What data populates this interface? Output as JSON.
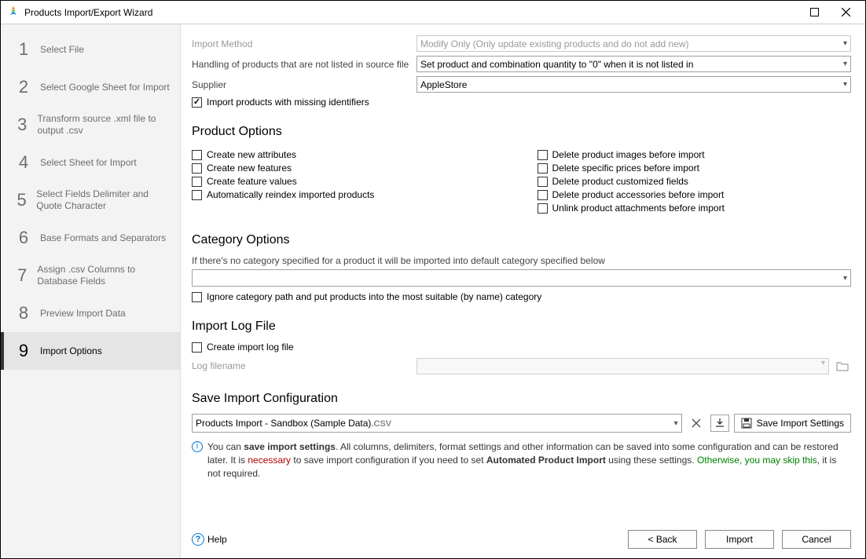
{
  "window": {
    "title": "Products Import/Export Wizard",
    "maximize_tooltip": "Maximize",
    "close_tooltip": "Close"
  },
  "sidebar": {
    "steps": [
      {
        "num": "1",
        "label": "Select File"
      },
      {
        "num": "2",
        "label": "Select Google Sheet for Import"
      },
      {
        "num": "3",
        "label": "Transform source .xml file to output .csv"
      },
      {
        "num": "4",
        "label": "Select Sheet for Import"
      },
      {
        "num": "5",
        "label": "Select Fields Delimiter and Quote Character"
      },
      {
        "num": "6",
        "label": "Base Formats and Separators"
      },
      {
        "num": "7",
        "label": "Assign .csv Columns to Database Fields"
      },
      {
        "num": "8",
        "label": "Preview Import Data"
      },
      {
        "num": "9",
        "label": "Import Options"
      }
    ],
    "active_index": 8
  },
  "header": {
    "import_method_label": "Import Method",
    "import_method_value": "Modify Only (Only update existing products and do not add new)",
    "handling_label": "Handling of products that are not listed in source file",
    "handling_value": "Set product and combination quantity to \"0\" when it is not listed in",
    "supplier_label": "Supplier",
    "supplier_value": "AppleStore",
    "missing_identifiers_label": "Import products with missing identifiers",
    "missing_identifiers_checked": true
  },
  "product_options": {
    "title": "Product Options",
    "left": [
      "Create new attributes",
      "Create new features",
      "Create feature values",
      "Automatically reindex imported products"
    ],
    "right": [
      "Delete product images before import",
      "Delete specific prices before import",
      "Delete product customized fields",
      "Delete product accessories before import",
      "Unlink product attachments before import"
    ]
  },
  "category_options": {
    "title": "Category Options",
    "hint": "If there's no category specified for a product it will be imported into default category specified below",
    "default_value": "",
    "ignore_label": "Ignore category path and put products into the most suitable (by name) category"
  },
  "import_log": {
    "title": "Import Log File",
    "create_label": "Create import log file",
    "filename_label": "Log filename"
  },
  "save_config": {
    "title": "Save Import Configuration",
    "value": "Products Import - Sandbox (Sample Data)",
    "ext": ".CSV",
    "save_btn": "Save Import Settings"
  },
  "info": {
    "t1": "You can ",
    "t2": "save import settings",
    "t3": ". All columns, delimiters, format settings and other information can be saved into some configuration and can be restored later. It is ",
    "t4": "necessary",
    "t5": " to save import configuration if you need to set ",
    "t6": "Automated Product Import",
    "t7": " using these settings. ",
    "t8": "Otherwise, you may skip this",
    "t9": ", it is not required."
  },
  "footer": {
    "help": "Help",
    "back": "< Back",
    "import": "Import",
    "cancel": "Cancel"
  }
}
